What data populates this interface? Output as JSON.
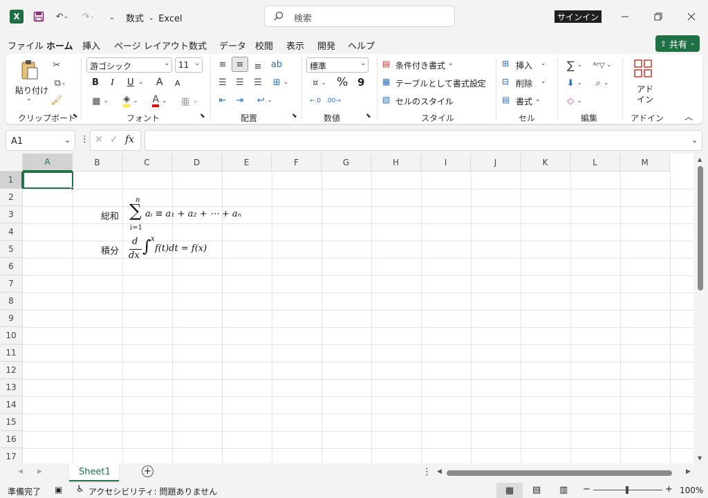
{
  "title": {
    "text": "数式  -  Excel"
  },
  "search": {
    "placeholder": "検索"
  },
  "signin": {
    "label": "サインイン"
  },
  "share": {
    "label": "共有"
  },
  "menu": {
    "items": [
      "ファイル",
      "ホーム",
      "挿入",
      "ページ レイアウト",
      "数式",
      "データ",
      "校閲",
      "表示",
      "開発",
      "ヘルプ"
    ],
    "active": "ホーム"
  },
  "ribbon": {
    "clipboard": {
      "paste_label": "貼り付け",
      "group_label": "クリップボード"
    },
    "font": {
      "name": "游ゴシック",
      "size": "11",
      "bold": "B",
      "italic": "I",
      "underline": "U",
      "grow": "A",
      "shrink": "A",
      "group_label": "フォント"
    },
    "align": {
      "group_label": "配置"
    },
    "number": {
      "format": "標準",
      "percent": "%",
      "comma": "9",
      "group_label": "数値"
    },
    "styles": {
      "conditional": "条件付き書式",
      "table": "テーブルとして書式設定",
      "cell_styles": "セルのスタイル",
      "group_label": "スタイル"
    },
    "cells": {
      "insert": "挿入",
      "delete": "削除",
      "format": "書式",
      "group_label": "セル"
    },
    "editing": {
      "group_label": "編集"
    },
    "addins": {
      "label_line1": "アド",
      "label_line2": "イン",
      "group_label": "アドイン"
    }
  },
  "formula_bar": {
    "name_box": "A1",
    "fx": "fx",
    "content": ""
  },
  "grid": {
    "columns": [
      "A",
      "B",
      "C",
      "D",
      "E",
      "F",
      "G",
      "H",
      "I",
      "J",
      "K",
      "L",
      "M"
    ],
    "rows": [
      "1",
      "2",
      "3",
      "4",
      "5",
      "6",
      "7",
      "8",
      "9",
      "10",
      "11",
      "12",
      "13",
      "14",
      "15",
      "16",
      "17"
    ],
    "selected_cell": "A1",
    "cells": {
      "B3": "総和",
      "B5": "積分"
    }
  },
  "equations": {
    "sum": {
      "upper": "n",
      "lower": "i=1",
      "sigma": "∑",
      "body": "aᵢ ≡ a₁ + a₂ + ⋯ + aₙ"
    },
    "integral": {
      "num": "d",
      "den": "dx",
      "sign": "∫",
      "upper": "x",
      "body": "f(t)dt = f(x)"
    }
  },
  "sheet_tabs": {
    "tabs": [
      "Sheet1"
    ],
    "active": "Sheet1"
  },
  "status": {
    "ready": "準備完了",
    "accessibility": "アクセシビリティ: 問題ありません",
    "zoom": "100%"
  },
  "colors": {
    "excel_green": "#217346",
    "share_green": "#1e7145",
    "selection": "#217346"
  },
  "icons": [
    "excel-logo-icon",
    "save-icon",
    "undo-icon",
    "redo-icon",
    "customize-icon",
    "search-icon",
    "minimize-icon",
    "restore-icon",
    "close-icon",
    "paste-icon",
    "cut-icon",
    "copy-icon",
    "format-painter-icon",
    "sum-icon",
    "sort-icon",
    "find-icon",
    "clear-icon",
    "fill-icon",
    "addins-icon"
  ]
}
